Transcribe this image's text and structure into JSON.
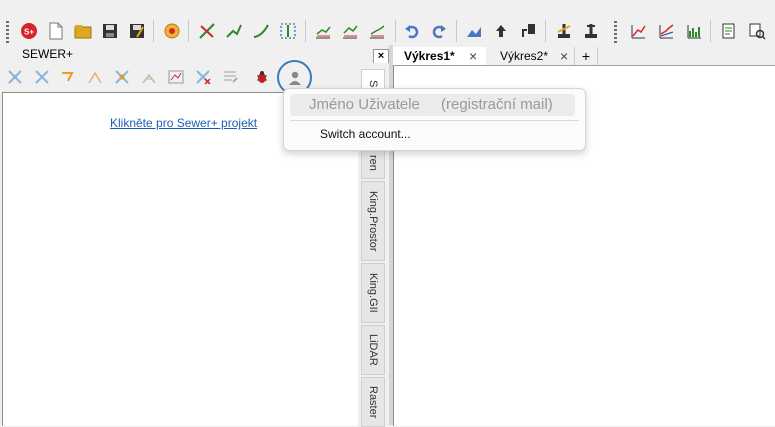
{
  "panel": {
    "title": "SEWER+",
    "close_label": "×",
    "link_text": "Klikněte pro Sewer+ projekt"
  },
  "vertical_tabs": [
    "Sev",
    "ren",
    "King.Prostor",
    "King.GII",
    "LiDAR",
    "Raster"
  ],
  "document_tabs": [
    {
      "label": "Výkres1*",
      "active": true
    },
    {
      "label": "Výkres2*",
      "active": false
    }
  ],
  "add_tab_label": "+",
  "close_glyph": "×",
  "account_menu": {
    "user_name": "Jméno Uživatele",
    "user_mail": "(registrační mail)",
    "switch_account": "Switch account..."
  },
  "colors": {
    "accent_ring": "#3a7ab8",
    "link": "#1a5fb4"
  },
  "toolbar_icons": [
    "sewer-plus-icon",
    "new-file-icon",
    "open-folder-icon",
    "save-icon",
    "save-as-icon",
    "compass-icon",
    "pipe-edit-icon",
    "pipe-profile-icon",
    "pipe-curve-icon",
    "node-align-icon",
    "chart-1-icon",
    "chart-2-icon",
    "chart-3-icon",
    "undo-icon",
    "redo-icon",
    "terrain-icon",
    "upload-icon",
    "export-icon",
    "level-1-icon",
    "level-2-icon",
    "line-chart-1-icon",
    "line-chart-2-icon",
    "line-chart-3-icon",
    "report-icon",
    "settings-search-icon"
  ]
}
